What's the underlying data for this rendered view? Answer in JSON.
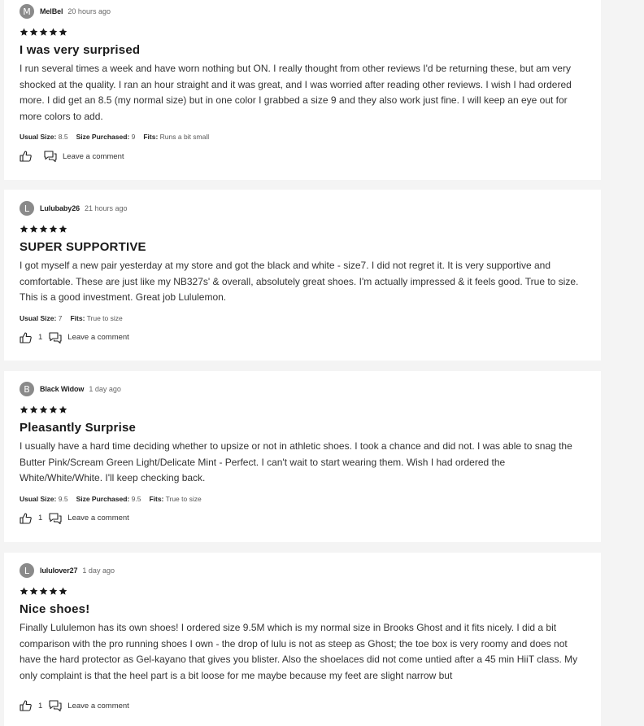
{
  "reviews": [
    {
      "avatar_letter": "M",
      "author": "MelBel",
      "time": "20 hours ago",
      "rating": 5,
      "title": "I was very surprised",
      "body": "I run several times a week and have worn nothing but ON. I really thought from other reviews I'd be returning these, but am very shocked at the quality. I ran an hour straight and it was great, and I was worried after reading other reviews. I wish I had ordered more. I did get an 8.5 (my normal size) but in one color I grabbed a size 9 and they also work just fine. I will keep an eye out for more colors to add.",
      "meta": [
        {
          "label": "Usual Size:",
          "value": "8.5"
        },
        {
          "label": "Size Purchased:",
          "value": "9"
        },
        {
          "label": "Fits:",
          "value": "Runs a bit small"
        }
      ],
      "likes": "",
      "comment_label": "Leave a comment"
    },
    {
      "avatar_letter": "L",
      "author": "Lulubaby26",
      "time": "21 hours ago",
      "rating": 5,
      "title": "SUPER SUPPORTIVE",
      "body": "I got myself a new pair yesterday at my store and got the black and white - size7. I did not regret it. It is very supportive and comfortable. These are just like my NB327s' & overall, absolutely great shoes. I'm actually impressed & it feels good. True to size. This is a good investment. Great job Lululemon.",
      "meta": [
        {
          "label": "Usual Size:",
          "value": "7"
        },
        {
          "label": "Fits:",
          "value": "True to size"
        }
      ],
      "likes": "1",
      "comment_label": "Leave a comment"
    },
    {
      "avatar_letter": "B",
      "author": "Black Widow",
      "time": "1 day ago",
      "rating": 5,
      "title": "Pleasantly Surprise",
      "body": "I usually have a hard time deciding whether to upsize or not in athletic shoes. I took a chance and did not. I was able to snag the Butter Pink/Scream Green Light/Delicate Mint - Perfect. I can't wait to start wearing them. Wish I had ordered the White/White/White. I'll keep checking back.",
      "meta": [
        {
          "label": "Usual Size:",
          "value": "9.5"
        },
        {
          "label": "Size Purchased:",
          "value": "9.5"
        },
        {
          "label": "Fits:",
          "value": "True to size"
        }
      ],
      "likes": "1",
      "comment_label": "Leave a comment"
    },
    {
      "avatar_letter": "L",
      "author": "lululover27",
      "time": "1 day ago",
      "rating": 5,
      "title": "Nice shoes!",
      "body": "Finally Lululemon has its own shoes! I ordered size 9.5M which is my normal size in Brooks Ghost and it fits nicely. I did a bit comparison with the pro running shoes I own - the drop of lulu is not as steep as Ghost; the toe box is very roomy and does not have the hard protector as Gel-kayano that gives you blister. Also the shoelaces did not come untied after a 45 min HiiT class. My only complaint is that the heel part is a bit loose for me maybe because my feet are slight narrow but",
      "meta": [],
      "likes": "1",
      "comment_label": "Leave a comment"
    }
  ],
  "colors": {
    "page_bg": "#f4f4f4",
    "card_bg": "#ffffff",
    "avatar_bg": "#8a8a8a",
    "star": "#1c1c1c"
  },
  "icons": {
    "like": "thumbs-up-icon",
    "comment": "comment-bubbles-icon",
    "star": "star-icon"
  }
}
